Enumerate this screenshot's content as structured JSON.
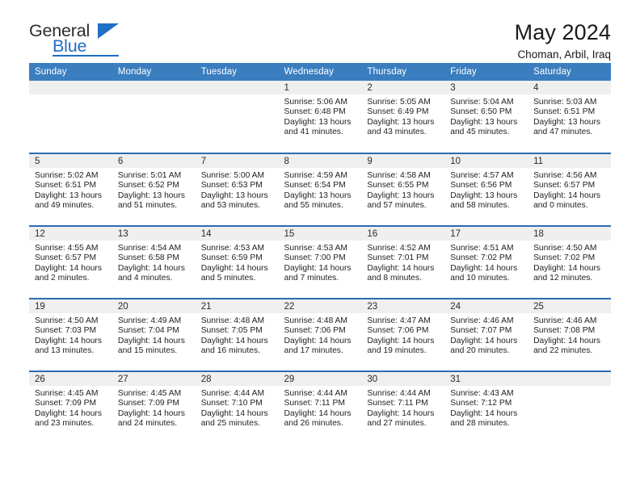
{
  "logo": {
    "word_top": "General",
    "word_bottom": "Blue",
    "triangle_color": "#1f6fc4",
    "text_color": "#2b2b2b"
  },
  "header": {
    "title": "May 2024",
    "subtitle": "Choman, Arbil, Iraq"
  },
  "theme": {
    "header_bg": "#3a7ebf",
    "row_divider": "#2a6cb0",
    "daynum_band_bg": "#efefef",
    "text": "#1a1a1a"
  },
  "weekday_headers": [
    "Sunday",
    "Monday",
    "Tuesday",
    "Wednesday",
    "Thursday",
    "Friday",
    "Saturday"
  ],
  "labels": {
    "sunrise_prefix": "Sunrise:",
    "sunset_prefix": "Sunset:",
    "daylight_prefix": "Daylight:"
  },
  "weeks": [
    [
      {
        "day": "",
        "lines": []
      },
      {
        "day": "",
        "lines": []
      },
      {
        "day": "",
        "lines": []
      },
      {
        "day": "1",
        "lines": [
          "Sunrise: 5:06 AM",
          "Sunset: 6:48 PM",
          "Daylight: 13 hours and 41 minutes."
        ]
      },
      {
        "day": "2",
        "lines": [
          "Sunrise: 5:05 AM",
          "Sunset: 6:49 PM",
          "Daylight: 13 hours and 43 minutes."
        ]
      },
      {
        "day": "3",
        "lines": [
          "Sunrise: 5:04 AM",
          "Sunset: 6:50 PM",
          "Daylight: 13 hours and 45 minutes."
        ]
      },
      {
        "day": "4",
        "lines": [
          "Sunrise: 5:03 AM",
          "Sunset: 6:51 PM",
          "Daylight: 13 hours and 47 minutes."
        ]
      }
    ],
    [
      {
        "day": "5",
        "lines": [
          "Sunrise: 5:02 AM",
          "Sunset: 6:51 PM",
          "Daylight: 13 hours and 49 minutes."
        ]
      },
      {
        "day": "6",
        "lines": [
          "Sunrise: 5:01 AM",
          "Sunset: 6:52 PM",
          "Daylight: 13 hours and 51 minutes."
        ]
      },
      {
        "day": "7",
        "lines": [
          "Sunrise: 5:00 AM",
          "Sunset: 6:53 PM",
          "Daylight: 13 hours and 53 minutes."
        ]
      },
      {
        "day": "8",
        "lines": [
          "Sunrise: 4:59 AM",
          "Sunset: 6:54 PM",
          "Daylight: 13 hours and 55 minutes."
        ]
      },
      {
        "day": "9",
        "lines": [
          "Sunrise: 4:58 AM",
          "Sunset: 6:55 PM",
          "Daylight: 13 hours and 57 minutes."
        ]
      },
      {
        "day": "10",
        "lines": [
          "Sunrise: 4:57 AM",
          "Sunset: 6:56 PM",
          "Daylight: 13 hours and 58 minutes."
        ]
      },
      {
        "day": "11",
        "lines": [
          "Sunrise: 4:56 AM",
          "Sunset: 6:57 PM",
          "Daylight: 14 hours and 0 minutes."
        ]
      }
    ],
    [
      {
        "day": "12",
        "lines": [
          "Sunrise: 4:55 AM",
          "Sunset: 6:57 PM",
          "Daylight: 14 hours and 2 minutes."
        ]
      },
      {
        "day": "13",
        "lines": [
          "Sunrise: 4:54 AM",
          "Sunset: 6:58 PM",
          "Daylight: 14 hours and 4 minutes."
        ]
      },
      {
        "day": "14",
        "lines": [
          "Sunrise: 4:53 AM",
          "Sunset: 6:59 PM",
          "Daylight: 14 hours and 5 minutes."
        ]
      },
      {
        "day": "15",
        "lines": [
          "Sunrise: 4:53 AM",
          "Sunset: 7:00 PM",
          "Daylight: 14 hours and 7 minutes."
        ]
      },
      {
        "day": "16",
        "lines": [
          "Sunrise: 4:52 AM",
          "Sunset: 7:01 PM",
          "Daylight: 14 hours and 8 minutes."
        ]
      },
      {
        "day": "17",
        "lines": [
          "Sunrise: 4:51 AM",
          "Sunset: 7:02 PM",
          "Daylight: 14 hours and 10 minutes."
        ]
      },
      {
        "day": "18",
        "lines": [
          "Sunrise: 4:50 AM",
          "Sunset: 7:02 PM",
          "Daylight: 14 hours and 12 minutes."
        ]
      }
    ],
    [
      {
        "day": "19",
        "lines": [
          "Sunrise: 4:50 AM",
          "Sunset: 7:03 PM",
          "Daylight: 14 hours and 13 minutes."
        ]
      },
      {
        "day": "20",
        "lines": [
          "Sunrise: 4:49 AM",
          "Sunset: 7:04 PM",
          "Daylight: 14 hours and 15 minutes."
        ]
      },
      {
        "day": "21",
        "lines": [
          "Sunrise: 4:48 AM",
          "Sunset: 7:05 PM",
          "Daylight: 14 hours and 16 minutes."
        ]
      },
      {
        "day": "22",
        "lines": [
          "Sunrise: 4:48 AM",
          "Sunset: 7:06 PM",
          "Daylight: 14 hours and 17 minutes."
        ]
      },
      {
        "day": "23",
        "lines": [
          "Sunrise: 4:47 AM",
          "Sunset: 7:06 PM",
          "Daylight: 14 hours and 19 minutes."
        ]
      },
      {
        "day": "24",
        "lines": [
          "Sunrise: 4:46 AM",
          "Sunset: 7:07 PM",
          "Daylight: 14 hours and 20 minutes."
        ]
      },
      {
        "day": "25",
        "lines": [
          "Sunrise: 4:46 AM",
          "Sunset: 7:08 PM",
          "Daylight: 14 hours and 22 minutes."
        ]
      }
    ],
    [
      {
        "day": "26",
        "lines": [
          "Sunrise: 4:45 AM",
          "Sunset: 7:09 PM",
          "Daylight: 14 hours and 23 minutes."
        ]
      },
      {
        "day": "27",
        "lines": [
          "Sunrise: 4:45 AM",
          "Sunset: 7:09 PM",
          "Daylight: 14 hours and 24 minutes."
        ]
      },
      {
        "day": "28",
        "lines": [
          "Sunrise: 4:44 AM",
          "Sunset: 7:10 PM",
          "Daylight: 14 hours and 25 minutes."
        ]
      },
      {
        "day": "29",
        "lines": [
          "Sunrise: 4:44 AM",
          "Sunset: 7:11 PM",
          "Daylight: 14 hours and 26 minutes."
        ]
      },
      {
        "day": "30",
        "lines": [
          "Sunrise: 4:44 AM",
          "Sunset: 7:11 PM",
          "Daylight: 14 hours and 27 minutes."
        ]
      },
      {
        "day": "31",
        "lines": [
          "Sunrise: 4:43 AM",
          "Sunset: 7:12 PM",
          "Daylight: 14 hours and 28 minutes."
        ]
      },
      {
        "day": "",
        "lines": []
      }
    ]
  ]
}
